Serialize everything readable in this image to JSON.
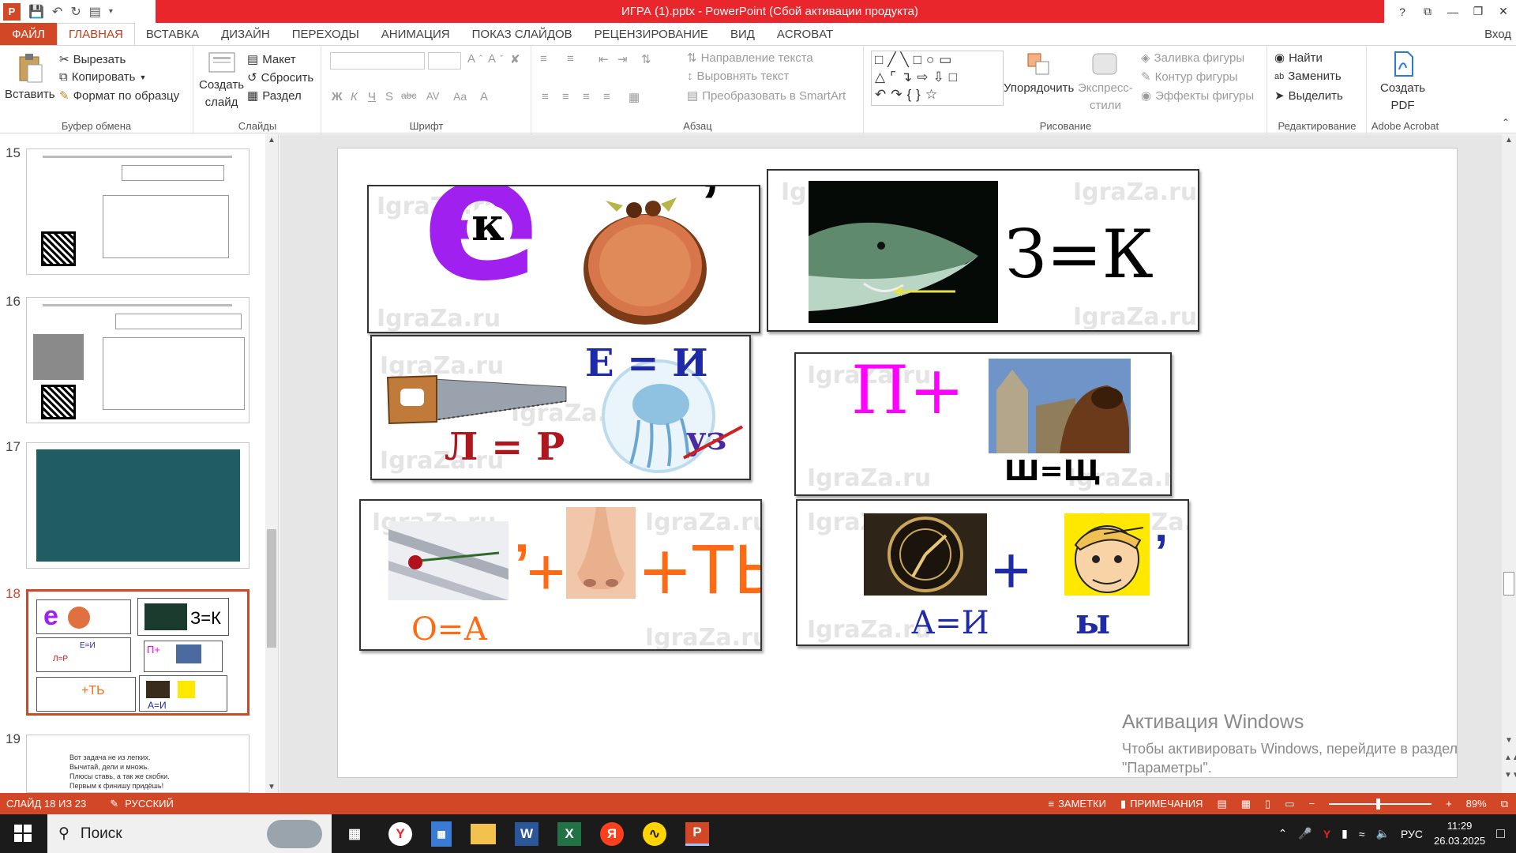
{
  "window": {
    "title": "ИГРА (1).pptx - PowerPoint (Сбой активации продукта)",
    "controls": [
      "?",
      "⧉",
      "—",
      "❐",
      "✕"
    ]
  },
  "tabs": {
    "file": "ФАЙЛ",
    "items": [
      "ГЛАВНАЯ",
      "ВСТАВКА",
      "ДИЗАЙН",
      "ПЕРЕХОДЫ",
      "АНИМАЦИЯ",
      "ПОКАЗ СЛАЙДОВ",
      "РЕЦЕНЗИРОВАНИЕ",
      "ВИД",
      "ACROBAT"
    ],
    "signin": "Вход"
  },
  "ribbon": {
    "clipboard": {
      "label": "Буфер обмена",
      "paste": "Вставить",
      "cut": "Вырезать",
      "copy": "Копировать",
      "format_painter": "Формат по образцу"
    },
    "slides": {
      "label": "Слайды",
      "new_slide_line1": "Создать",
      "new_slide_line2": "слайд",
      "layout": "Макет",
      "reset": "Сбросить",
      "section": "Раздел"
    },
    "font": {
      "label": "Шрифт"
    },
    "paragraph": {
      "label": "Абзац",
      "text_direction": "Направление текста",
      "align_text": "Выровнять текст",
      "convert_smartart": "Преобразовать в SmartArt"
    },
    "drawing": {
      "label": "Рисование",
      "arrange": "Упорядочить",
      "quick_styles_line1": "Экспресс-",
      "quick_styles_line2": "стили",
      "shape_fill": "Заливка фигуры",
      "shape_outline": "Контур фигуры",
      "shape_effects": "Эффекты фигуры"
    },
    "editing": {
      "label": "Редактирование",
      "find": "Найти",
      "replace": "Заменить",
      "select": "Выделить"
    },
    "acrobat": {
      "label": "Adobe Acrobat",
      "create_pdf_line1": "Создать",
      "create_pdf_line2": "PDF"
    }
  },
  "thumbnails": [
    {
      "number": "15"
    },
    {
      "number": "16"
    },
    {
      "number": "17"
    },
    {
      "number": "18"
    },
    {
      "number": "19",
      "lines": [
        "Вот задача не из легких.",
        "Вычитай, дели и множь.",
        "Плюсы ставь, а так же скобки.",
        "Первым к финишу придёшь!"
      ]
    }
  ],
  "slide": {
    "watermark": "IgraZa.ru",
    "cards": {
      "c1": {
        "letter": "е",
        "small_letter": "к",
        "mark": "’"
      },
      "c2": {
        "formula": "З=К"
      },
      "c3": {
        "formula_top": "Е = И",
        "formula_bottom": "Л = Р",
        "strike": "уз"
      },
      "c4": {
        "prefix": "П+",
        "formula": "Ш=Щ"
      },
      "c5": {
        "mark": "’",
        "plus1": "+",
        "plus2": "+ТЬ",
        "formula": "О=А"
      },
      "c6": {
        "plus": "+",
        "mark": "’",
        "formula": "А=И",
        "letter": "ы"
      }
    }
  },
  "activation": {
    "title": "Активация Windows",
    "text": "Чтобы активировать Windows, перейдите в раздел \"Параметры\"."
  },
  "statusbar": {
    "slide_info": "СЛАЙД 18 ИЗ 23",
    "language": "РУССКИЙ",
    "notes": "ЗАМЕТКИ",
    "comments": "ПРИМЕЧАНИЯ",
    "zoom": "89%"
  },
  "taskbar": {
    "search_placeholder": "Поиск",
    "time": "11:29",
    "date": "26.03.2025",
    "lang": "РУС"
  },
  "colors": {
    "accent": "#d24726",
    "title_red": "#e8262b",
    "purple": "#a020f0",
    "navy": "#1f2aa8",
    "magenta": "#ff00ff",
    "orange": "#ff6a13",
    "darkred": "#b0161e"
  }
}
